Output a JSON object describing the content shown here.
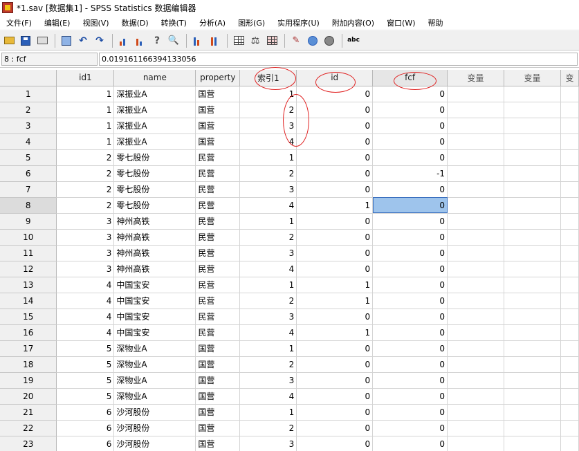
{
  "title": "*1.sav [数据集1] - SPSS Statistics 数据编辑器",
  "menu": [
    "文件(F)",
    "编辑(E)",
    "视图(V)",
    "数据(D)",
    "转换(T)",
    "分析(A)",
    "图形(G)",
    "实用程序(U)",
    "附加内容(O)",
    "窗口(W)",
    "帮助"
  ],
  "toolbar_icons": [
    "open-icon",
    "save-icon",
    "print-icon",
    "dialog-recall-icon",
    "undo-icon",
    "redo-icon",
    "goto-case-icon",
    "goto-variable-icon",
    "variables-icon",
    "find-icon",
    "insert-cases-icon",
    "insert-variable-icon",
    "split-file-icon",
    "weight-cases-icon",
    "select-cases-icon",
    "value-labels-icon",
    "use-sets-icon",
    "show-all-icon",
    "spell-check-icon"
  ],
  "cellbar": {
    "ref": "8 : fcf",
    "value": "0.019161166394133056"
  },
  "columns": [
    "id1",
    "name",
    "property",
    "索引1",
    "id",
    "fcf",
    "变量",
    "变量",
    "变"
  ],
  "rows": [
    {
      "n": "1",
      "id1": "1",
      "name": "深振业A",
      "property": "国营",
      "idx": "1",
      "id": "0",
      "fcf": "0"
    },
    {
      "n": "2",
      "id1": "1",
      "name": "深振业A",
      "property": "国营",
      "idx": "2",
      "id": "0",
      "fcf": "0"
    },
    {
      "n": "3",
      "id1": "1",
      "name": "深振业A",
      "property": "国营",
      "idx": "3",
      "id": "0",
      "fcf": "0"
    },
    {
      "n": "4",
      "id1": "1",
      "name": "深振业A",
      "property": "国营",
      "idx": "4",
      "id": "0",
      "fcf": "0"
    },
    {
      "n": "5",
      "id1": "2",
      "name": "零七股份",
      "property": "民营",
      "idx": "1",
      "id": "0",
      "fcf": "0"
    },
    {
      "n": "6",
      "id1": "2",
      "name": "零七股份",
      "property": "民营",
      "idx": "2",
      "id": "0",
      "fcf": "-1"
    },
    {
      "n": "7",
      "id1": "2",
      "name": "零七股份",
      "property": "民营",
      "idx": "3",
      "id": "0",
      "fcf": "0"
    },
    {
      "n": "8",
      "id1": "2",
      "name": "零七股份",
      "property": "民营",
      "idx": "4",
      "id": "1",
      "fcf": "0"
    },
    {
      "n": "9",
      "id1": "3",
      "name": "神州高铁",
      "property": "民营",
      "idx": "1",
      "id": "0",
      "fcf": "0"
    },
    {
      "n": "10",
      "id1": "3",
      "name": "神州高铁",
      "property": "民营",
      "idx": "2",
      "id": "0",
      "fcf": "0"
    },
    {
      "n": "11",
      "id1": "3",
      "name": "神州高铁",
      "property": "民营",
      "idx": "3",
      "id": "0",
      "fcf": "0"
    },
    {
      "n": "12",
      "id1": "3",
      "name": "神州高铁",
      "property": "民营",
      "idx": "4",
      "id": "0",
      "fcf": "0"
    },
    {
      "n": "13",
      "id1": "4",
      "name": "中国宝安",
      "property": "民营",
      "idx": "1",
      "id": "1",
      "fcf": "0"
    },
    {
      "n": "14",
      "id1": "4",
      "name": "中国宝安",
      "property": "民营",
      "idx": "2",
      "id": "1",
      "fcf": "0"
    },
    {
      "n": "15",
      "id1": "4",
      "name": "中国宝安",
      "property": "民营",
      "idx": "3",
      "id": "0",
      "fcf": "0"
    },
    {
      "n": "16",
      "id1": "4",
      "name": "中国宝安",
      "property": "民营",
      "idx": "4",
      "id": "1",
      "fcf": "0"
    },
    {
      "n": "17",
      "id1": "5",
      "name": "深物业A",
      "property": "国营",
      "idx": "1",
      "id": "0",
      "fcf": "0"
    },
    {
      "n": "18",
      "id1": "5",
      "name": "深物业A",
      "property": "国营",
      "idx": "2",
      "id": "0",
      "fcf": "0"
    },
    {
      "n": "19",
      "id1": "5",
      "name": "深物业A",
      "property": "国营",
      "idx": "3",
      "id": "0",
      "fcf": "0"
    },
    {
      "n": "20",
      "id1": "5",
      "name": "深物业A",
      "property": "国营",
      "idx": "4",
      "id": "0",
      "fcf": "0"
    },
    {
      "n": "21",
      "id1": "6",
      "name": "沙河股份",
      "property": "国营",
      "idx": "1",
      "id": "0",
      "fcf": "0"
    },
    {
      "n": "22",
      "id1": "6",
      "name": "沙河股份",
      "property": "国营",
      "idx": "2",
      "id": "0",
      "fcf": "0"
    },
    {
      "n": "23",
      "id1": "6",
      "name": "沙河股份",
      "property": "国营",
      "idx": "3",
      "id": "0",
      "fcf": "0"
    }
  ],
  "selected_row": "8",
  "colors": {
    "selection": "#9ec4ec",
    "annotation": "#e02020"
  }
}
